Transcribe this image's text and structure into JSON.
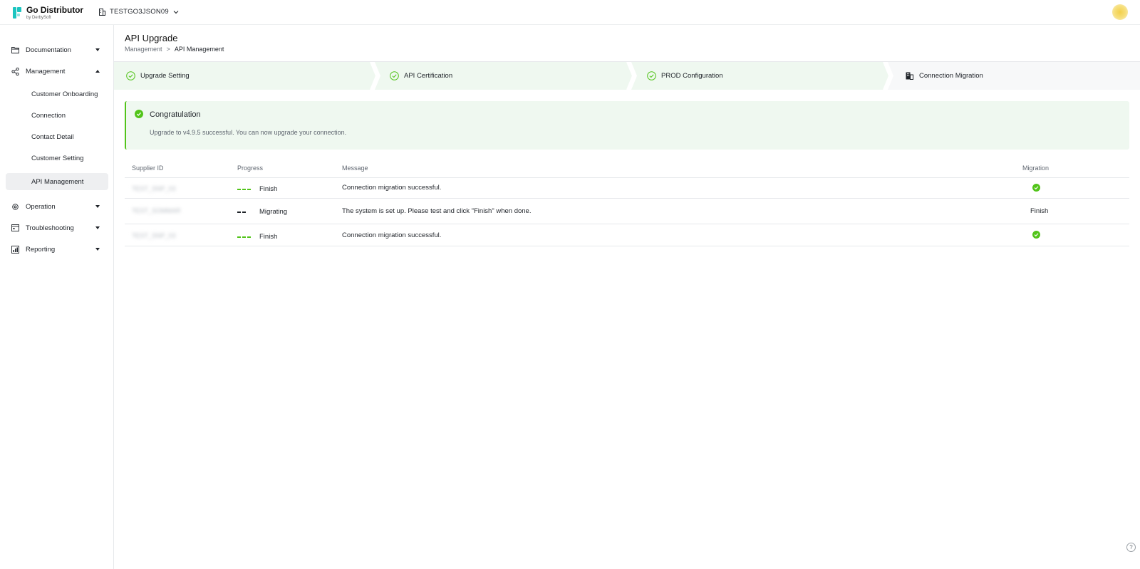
{
  "app": {
    "title": "Go Distributor",
    "subtitle": "by DerbySoft",
    "tenant": "TESTGO3JSON09",
    "brand_color": "#1bc5c0"
  },
  "sidebar": {
    "items": [
      {
        "label": "Documentation",
        "icon": "folder-icon",
        "expanded": false
      },
      {
        "label": "Management",
        "icon": "share-icon",
        "expanded": true
      },
      {
        "label": "Operation",
        "icon": "gear-icon",
        "expanded": false
      },
      {
        "label": "Troubleshooting",
        "icon": "browser-window-icon",
        "expanded": false
      },
      {
        "label": "Reporting",
        "icon": "report-icon",
        "expanded": false
      }
    ],
    "management_sub_items": [
      {
        "label": "Customer Onboarding",
        "active": false
      },
      {
        "label": "Connection",
        "active": false
      },
      {
        "label": "Contact Detail",
        "active": false
      },
      {
        "label": "Customer Setting",
        "active": false
      },
      {
        "label": "API Management",
        "active": true
      }
    ]
  },
  "page": {
    "title": "API Upgrade",
    "breadcrumb": [
      "Management",
      "API Management"
    ],
    "breadcrumb_separator": ">"
  },
  "steps": [
    {
      "label": "Upgrade Setting",
      "status": "done",
      "icon": "check-circle-icon"
    },
    {
      "label": "API Certification",
      "status": "done",
      "icon": "check-circle-icon"
    },
    {
      "label": "PROD Configuration",
      "status": "done",
      "icon": "check-circle-icon"
    },
    {
      "label": "Connection Migration",
      "status": "current",
      "icon": "building-icon"
    }
  ],
  "alert": {
    "title": "Congratulation",
    "message": "Upgrade to v4.9.5 successful. You can now upgrade your connection.",
    "color": "#52c41a",
    "background": "#eff8f0"
  },
  "table": {
    "columns": [
      "Supplier ID",
      "Progress",
      "Message",
      "Migration"
    ],
    "rows": [
      {
        "supplier_id": "TEST_SNP_03",
        "progress": "Finish",
        "progress_color": "#52c41a",
        "message": "Connection migration successful.",
        "migration": "check"
      },
      {
        "supplier_id": "TEST_SOMMAR",
        "progress": "Migrating",
        "progress_color": "#1f2329",
        "message": "The system is set up. Please test and click \"Finish\" when done.",
        "migration": "Finish"
      },
      {
        "supplier_id": "TEST_SNP_03",
        "progress": "Finish",
        "progress_color": "#52c41a",
        "message": "Connection migration successful.",
        "migration": "check"
      }
    ]
  },
  "help": {
    "label": "?"
  }
}
